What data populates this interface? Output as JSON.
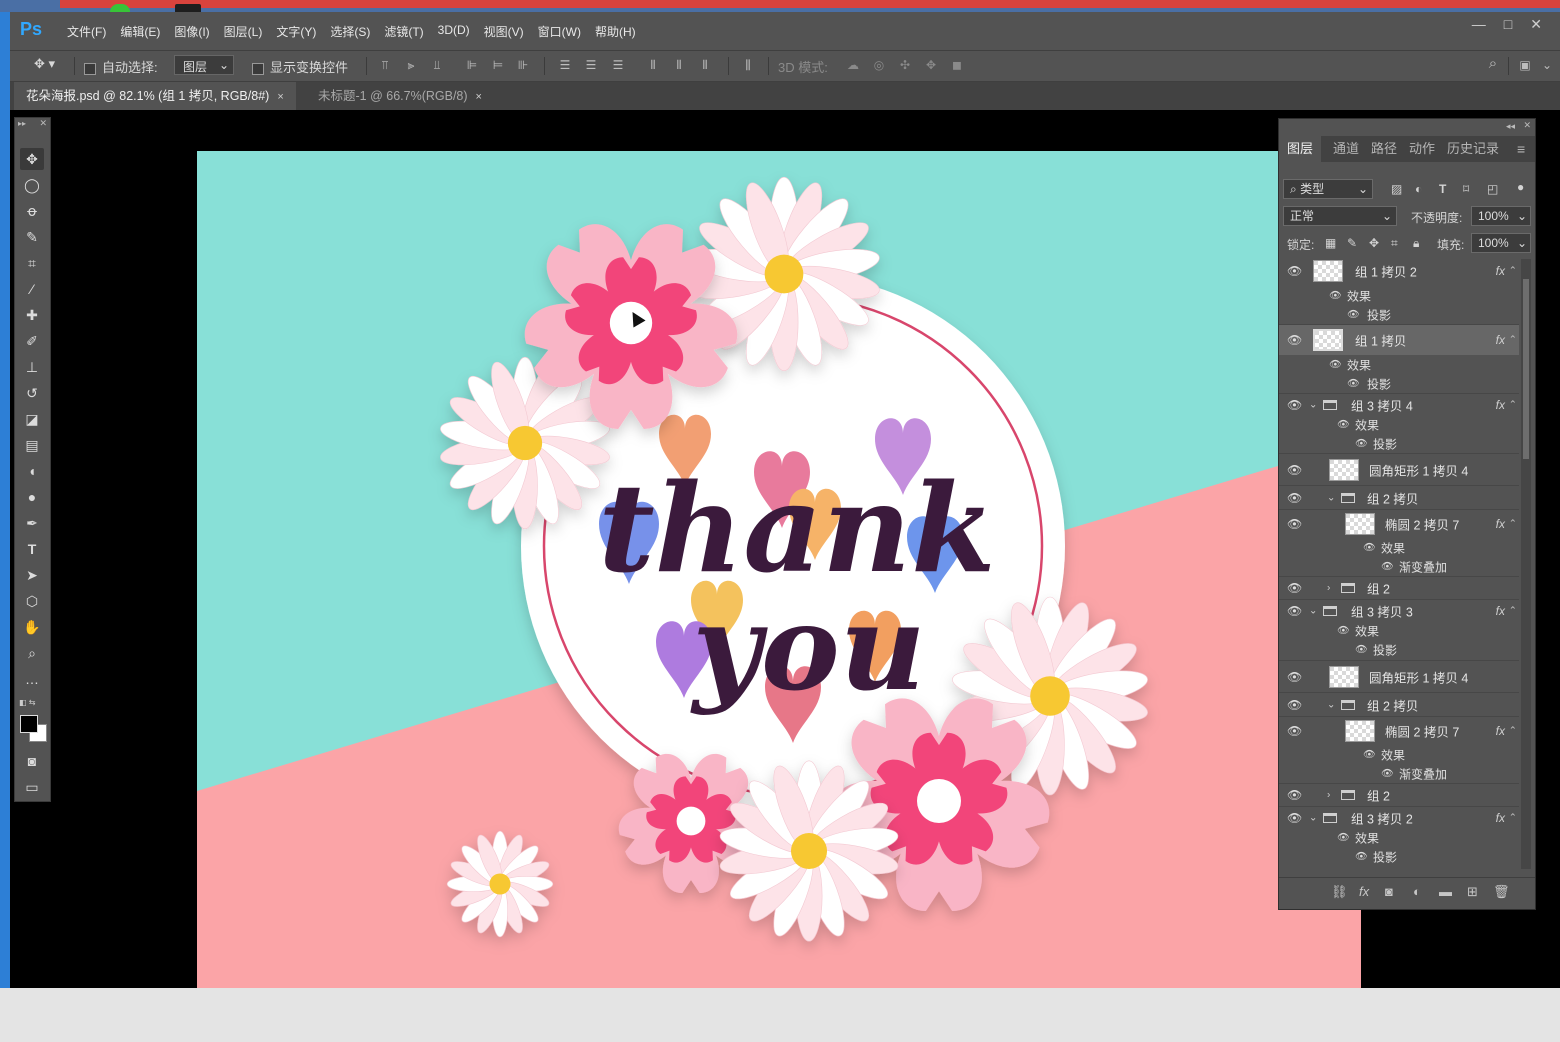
{
  "app": {
    "logo": "Ps",
    "menus": [
      "文件(F)",
      "编辑(E)",
      "图像(I)",
      "图层(L)",
      "文字(Y)",
      "选择(S)",
      "滤镜(T)",
      "3D(D)",
      "视图(V)",
      "窗口(W)",
      "帮助(H)"
    ],
    "window_buttons": [
      "—",
      "□",
      "✕"
    ]
  },
  "options": {
    "auto_select_label": "自动选择:",
    "auto_select_value": "图层",
    "show_transform_label": "显示变换控件",
    "mode_3d_label": "3D 模式:"
  },
  "tabs": [
    {
      "label": "花朵海报.psd @ 82.1% (组 1 拷贝, RGB/8#)",
      "close": "×"
    },
    {
      "label": "未标题-1 @ 66.7%(RGB/8)",
      "close": "×"
    }
  ],
  "artwork": {
    "line1": "thank",
    "line2": "you",
    "colors": {
      "teal": "#88e0d7",
      "pink": "#fba4a7",
      "ring": "#d8466c",
      "text": "#3b1a3c"
    }
  },
  "layers_panel": {
    "tabs": [
      "图层",
      "通道",
      "路径",
      "动作",
      "历史记录"
    ],
    "filter_label": "类型",
    "blend_mode": "正常",
    "opacity_label": "不透明度:",
    "opacity_value": "100%",
    "lock_label": "锁定:",
    "fill_label": "填充:",
    "fill_value": "100%",
    "fx_label": "fx",
    "layers": [
      {
        "name": "组 1 拷贝 2",
        "effects": "效果",
        "sub": "投影"
      },
      {
        "name": "组 1 拷贝",
        "effects": "效果",
        "sub": "投影"
      },
      {
        "name": "组 3 拷贝 4",
        "effects": "效果",
        "sub": "投影"
      },
      {
        "name": "圆角矩形 1 拷贝 4"
      },
      {
        "name": "组 2 拷贝"
      },
      {
        "name": "椭圆 2 拷贝 7",
        "effects": "效果",
        "sub": "渐变叠加"
      },
      {
        "name": "组 2"
      },
      {
        "name": "组 3 拷贝 3",
        "effects": "效果",
        "sub": "投影"
      },
      {
        "name": "圆角矩形 1 拷贝 4"
      },
      {
        "name": "组 2 拷贝"
      },
      {
        "name": "椭圆 2 拷贝 7",
        "effects": "效果",
        "sub": "渐变叠加"
      },
      {
        "name": "组 2"
      },
      {
        "name": "组 3 拷贝 2",
        "effects": "效果",
        "sub": "投影"
      }
    ]
  }
}
